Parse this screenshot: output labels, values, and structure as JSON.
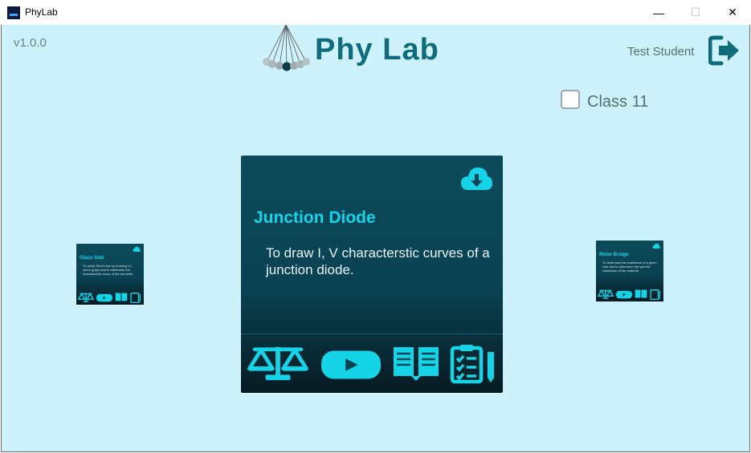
{
  "window": {
    "title": "PhyLab",
    "minimize": "—",
    "maximize": "☐",
    "close": "✕"
  },
  "header": {
    "version": "v1.0.0",
    "logo_text": "Phy Lab",
    "user_name": "Test Student"
  },
  "class_filter": {
    "label": "Class 11",
    "checked": false
  },
  "colors": {
    "background": "#cdf2fc",
    "accent": "#15d4e8",
    "card": "#0a4353",
    "logo": "#0e6c7c"
  },
  "cards": {
    "main": {
      "title": "Junction Diode",
      "description": "To draw I, V characterstic curves of a junction diode.",
      "icons": [
        "download-icon",
        "balance-icon",
        "video-icon",
        "book-icon",
        "clipboard-icon"
      ]
    },
    "left": {
      "title": "Glass Slab",
      "description": "To verify Ohm's law by drawing V-I curve graph and to determine the characteristic curve of the Ammeter"
    },
    "right": {
      "title": "Meter Bridge",
      "description": "To determine the resistance of a given wire and to determine the specific resistance of the material"
    }
  }
}
